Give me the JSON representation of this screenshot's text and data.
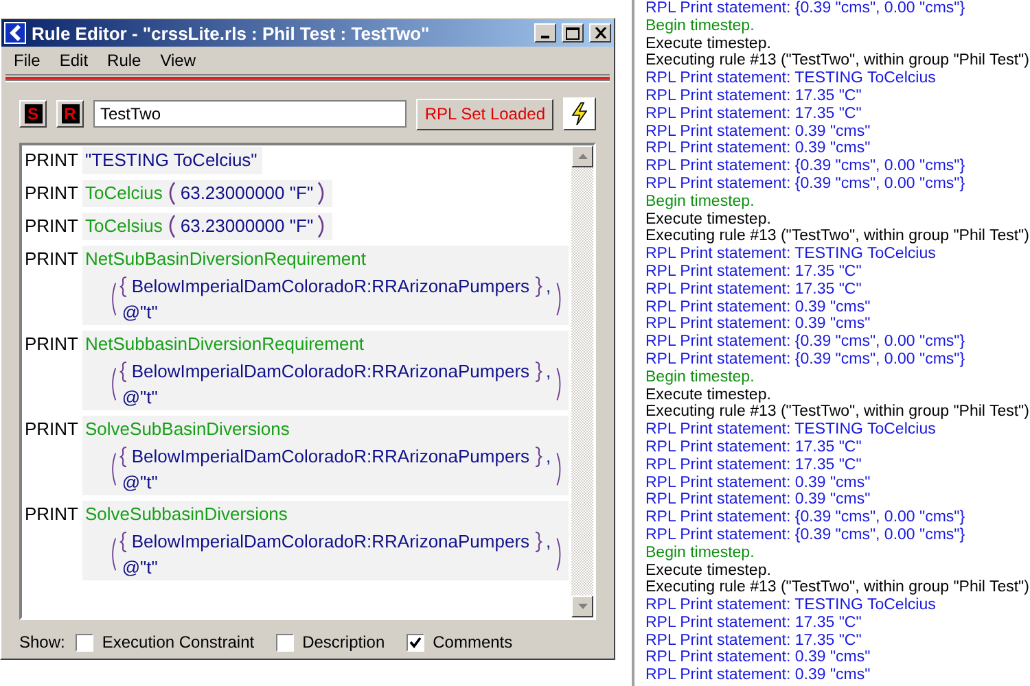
{
  "window": {
    "title": "Rule Editor - \"crssLite.rls : Phil Test : TestTwo\""
  },
  "menu": [
    "File",
    "Edit",
    "Rule",
    "View"
  ],
  "toolbar": {
    "buttons": [
      {
        "label": "S"
      },
      {
        "label": "R"
      }
    ],
    "name_field": {
      "value": "TestTwo"
    },
    "status_button": "RPL Set Loaded"
  },
  "statements": [
    {
      "keyword": "PRINT",
      "kind": "string",
      "text": "\"TESTING ToCelcius\""
    },
    {
      "keyword": "PRINT",
      "kind": "call",
      "function": "ToCelcius",
      "args": "63.23000000 \"F\""
    },
    {
      "keyword": "PRINT",
      "kind": "call",
      "function": "ToCelsius",
      "args": "63.23000000 \"F\""
    },
    {
      "keyword": "PRINT",
      "kind": "block",
      "function": "NetSubBasinDiversionRequirement",
      "set_item": "BelowImperialDamColoradoR:RRArizonaPumpers",
      "separator": ",",
      "arg2": "@\"t\""
    },
    {
      "keyword": "PRINT",
      "kind": "block",
      "function": "NetSubbasinDiversionRequirement",
      "set_item": "BelowImperialDamColoradoR:RRArizonaPumpers",
      "separator": ",",
      "arg2": "@\"t\""
    },
    {
      "keyword": "PRINT",
      "kind": "block",
      "function": "SolveSubBasinDiversions",
      "set_item": "BelowImperialDamColoradoR:RRArizonaPumpers",
      "separator": ",",
      "arg2": "@\"t\""
    },
    {
      "keyword": "PRINT",
      "kind": "block",
      "function": "SolveSubbasinDiversions",
      "set_item": "BelowImperialDamColoradoR:RRArizonaPumpers",
      "separator": ",",
      "arg2": "@\"t\""
    }
  ],
  "show": {
    "label": "Show:",
    "options": [
      {
        "label": "Execution Constraint",
        "checked": false
      },
      {
        "label": "Description",
        "checked": false
      },
      {
        "label": "Comments",
        "checked": true
      }
    ]
  },
  "log": [
    {
      "kind": "print",
      "text": "RPL Print statement: {0.39 \"cms\", 0.00 \"cms\"}"
    },
    {
      "kind": "begin",
      "text": "Begin timestep."
    },
    {
      "kind": "info",
      "text": "Execute timestep."
    },
    {
      "kind": "info",
      "text": "Executing rule #13 (\"TestTwo\", within group \"Phil Test\")"
    },
    {
      "kind": "print",
      "text": "RPL Print statement: TESTING ToCelcius"
    },
    {
      "kind": "print",
      "text": "RPL Print statement: 17.35 \"C\""
    },
    {
      "kind": "print",
      "text": "RPL Print statement: 17.35 \"C\""
    },
    {
      "kind": "print",
      "text": "RPL Print statement: 0.39 \"cms\""
    },
    {
      "kind": "print",
      "text": "RPL Print statement: 0.39 \"cms\""
    },
    {
      "kind": "print",
      "text": "RPL Print statement: {0.39 \"cms\", 0.00 \"cms\"}"
    },
    {
      "kind": "print",
      "text": "RPL Print statement: {0.39 \"cms\", 0.00 \"cms\"}"
    },
    {
      "kind": "begin",
      "text": "Begin timestep."
    },
    {
      "kind": "info",
      "text": "Execute timestep."
    },
    {
      "kind": "info",
      "text": "Executing rule #13 (\"TestTwo\", within group \"Phil Test\")"
    },
    {
      "kind": "print",
      "text": "RPL Print statement: TESTING ToCelcius"
    },
    {
      "kind": "print",
      "text": "RPL Print statement: 17.35 \"C\""
    },
    {
      "kind": "print",
      "text": "RPL Print statement: 17.35 \"C\""
    },
    {
      "kind": "print",
      "text": "RPL Print statement: 0.39 \"cms\""
    },
    {
      "kind": "print",
      "text": "RPL Print statement: 0.39 \"cms\""
    },
    {
      "kind": "print",
      "text": "RPL Print statement: {0.39 \"cms\", 0.00 \"cms\"}"
    },
    {
      "kind": "print",
      "text": "RPL Print statement: {0.39 \"cms\", 0.00 \"cms\"}"
    },
    {
      "kind": "begin",
      "text": "Begin timestep."
    },
    {
      "kind": "info",
      "text": "Execute timestep."
    },
    {
      "kind": "info",
      "text": "Executing rule #13 (\"TestTwo\", within group \"Phil Test\")"
    },
    {
      "kind": "print",
      "text": "RPL Print statement: TESTING ToCelcius"
    },
    {
      "kind": "print",
      "text": "RPL Print statement: 17.35 \"C\""
    },
    {
      "kind": "print",
      "text": "RPL Print statement: 17.35 \"C\""
    },
    {
      "kind": "print",
      "text": "RPL Print statement: 0.39 \"cms\""
    },
    {
      "kind": "print",
      "text": "RPL Print statement: 0.39 \"cms\""
    },
    {
      "kind": "print",
      "text": "RPL Print statement: {0.39 \"cms\", 0.00 \"cms\"}"
    },
    {
      "kind": "print",
      "text": "RPL Print statement: {0.39 \"cms\", 0.00 \"cms\"}"
    },
    {
      "kind": "begin",
      "text": "Begin timestep."
    },
    {
      "kind": "info",
      "text": "Execute timestep."
    },
    {
      "kind": "info",
      "text": "Executing rule #13 (\"TestTwo\", within group \"Phil Test\")"
    },
    {
      "kind": "print",
      "text": "RPL Print statement: TESTING ToCelcius"
    },
    {
      "kind": "print",
      "text": "RPL Print statement: 17.35 \"C\""
    },
    {
      "kind": "print",
      "text": "RPL Print statement: 17.35 \"C\""
    },
    {
      "kind": "print",
      "text": "RPL Print statement: 0.39 \"cms\""
    },
    {
      "kind": "print",
      "text": "RPL Print statement: 0.39 \"cms\""
    }
  ]
}
